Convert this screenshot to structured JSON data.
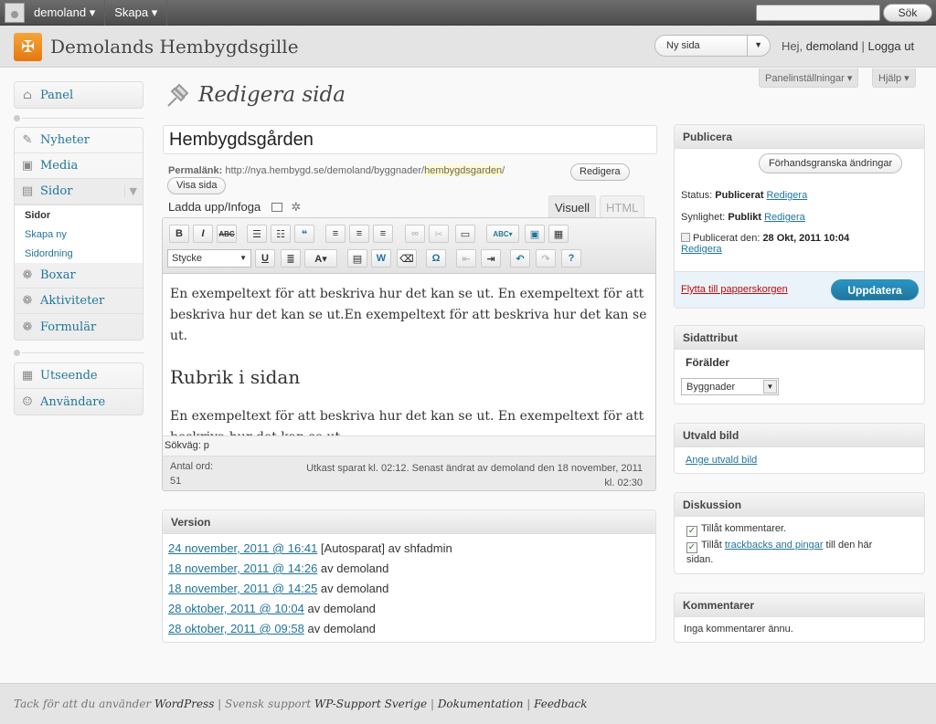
{
  "adminbar": {
    "site": "demoland ▾",
    "create": "Skapa ▾",
    "search_button": "Sök"
  },
  "header": {
    "title": "Demolands Hembygdsgille",
    "favorite": "Ny sida",
    "greeting": "Hej,",
    "user": "demoland",
    "separator": " | ",
    "logout": "Logga ut"
  },
  "screen_meta": {
    "options": "Panelinställningar ▾",
    "help": "Hjälp ▾"
  },
  "menu": {
    "dashboard": "Panel",
    "posts": "Nyheter",
    "media": "Media",
    "pages": "Sidor",
    "pages_sub": [
      "Sidor",
      "Skapa ny",
      "Sidordning"
    ],
    "boxes": "Boxar",
    "activities": "Aktiviteter",
    "forms": "Formulär",
    "appearance": "Utseende",
    "users": "Användare"
  },
  "page": {
    "heading": "Redigera sida",
    "title_value": "Hembygdsgården",
    "permalink_label": "Permalänk:",
    "permalink_base": "http://nya.hembygd.se/demoland/byggnader/",
    "permalink_slug": "hembygdsgarden",
    "permalink_end": "/",
    "edit_slug": "Redigera",
    "view_page": "Visa sida",
    "upload_label": "Ladda upp/Infoga"
  },
  "editor": {
    "tab_visual": "Visuell",
    "tab_html": "HTML",
    "style_select": "Stycke",
    "paragraph1": "En exempeltext för att beskriva hur det kan se ut. En exempeltext för att beskriva hur det kan se ut.En exempeltext för att beskriva hur det kan se ut.",
    "heading": "Rubrik i sidan",
    "paragraph2": "En exempeltext för att beskriva hur det kan se ut. En exempeltext för att beskriva hur det kan se ut.",
    "path": "Sökväg: p",
    "word_count_label": "Antal ord:",
    "word_count": "51",
    "autosave_line1": "Utkast sparat kl. 02:12. Senast ändrat av demoland den 18 november, 2011",
    "autosave_line2": "kl. 02:30"
  },
  "versions": {
    "title": "Version",
    "items": [
      {
        "date": "24 november, 2011 @ 16:41",
        "by": " [Autosparat] av shfadmin"
      },
      {
        "date": "18 november, 2011 @ 14:26",
        "by": " av demoland"
      },
      {
        "date": "18 november, 2011 @ 14:25",
        "by": " av demoland"
      },
      {
        "date": "28 oktober, 2011 @ 10:04",
        "by": " av demoland"
      },
      {
        "date": "28 oktober, 2011 @ 09:58",
        "by": " av demoland"
      }
    ]
  },
  "publish": {
    "title": "Publicera",
    "preview": "Förhandsgranska ändringar",
    "status_label": "Status: ",
    "status_value": "Publicerat",
    "status_edit": "Redigera",
    "visibility_label": "Synlighet: ",
    "visibility_value": "Publikt",
    "visibility_edit": "Redigera",
    "date_label": "Publicerat den: ",
    "date_value": "28 Okt, 2011 10:04",
    "date_edit": "Redigera",
    "trash": "Flytta till papperskorgen",
    "update": "Uppdatera"
  },
  "attributes": {
    "title": "Sidattribut",
    "parent_label": "Förälder",
    "parent_value": "Byggnader"
  },
  "featured": {
    "title": "Utvald bild",
    "link": "Ange utvald bild"
  },
  "discussion": {
    "title": "Diskussion",
    "comments": "Tillåt kommentarer.",
    "trackbacks_pre": "Tillåt ",
    "trackbacks_link": "trackbacks and pingar",
    "trackbacks_post": " till den här",
    "trackbacks_line2": "sidan."
  },
  "comments": {
    "title": "Kommentarer",
    "none": "Inga kommentarer ännu."
  },
  "footer": {
    "thanks": "Tack för att du använder ",
    "wordpress": "WordPress",
    "sep1": " | Svensk support ",
    "support": "WP-Support Sverige",
    "sep2": " | ",
    "docs": "Dokumentation",
    "sep3": " | ",
    "feedback": "Feedback"
  }
}
